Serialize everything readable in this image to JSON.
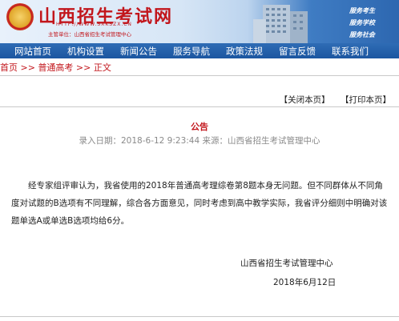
{
  "header": {
    "title": "山西招生考试网",
    "url": "HTTP://WWW.SXKSZX.CN",
    "sponsor": "主管单位：山西省招生考试管理中心",
    "slogans": [
      "服务考生",
      "服务学校",
      "服务社会"
    ]
  },
  "nav": {
    "items": [
      "网站首页",
      "机构设置",
      "新闻公告",
      "服务导航",
      "政策法规",
      "留言反馈",
      "联系我们"
    ]
  },
  "breadcrumb": {
    "home": "首页",
    "sep1": " >> ",
    "section": "普通高考",
    "sep2": " >> ",
    "current": "正文"
  },
  "actions": {
    "close": "【关闭本页】",
    "print": "【打印本页】"
  },
  "article": {
    "title": "公告",
    "meta": "录入日期：2018-6-12 9:23:44   来源：山西省招生考试管理中心",
    "body": "经专家组评审认为，我省使用的2018年普通高考理综卷第8题本身无问题。但不同群体从不同角度对试题的B选项有不同理解，综合各方面意见，同时考虑到高中教学实际，我省评分细则中明确对该题单选A或单选B选项均给6分。",
    "signature_org": "山西省招生考试管理中心",
    "signature_date": "2018年6月12日"
  },
  "colors": {
    "brand_red": "#c2161c",
    "nav_blue": "#1c56a0"
  }
}
